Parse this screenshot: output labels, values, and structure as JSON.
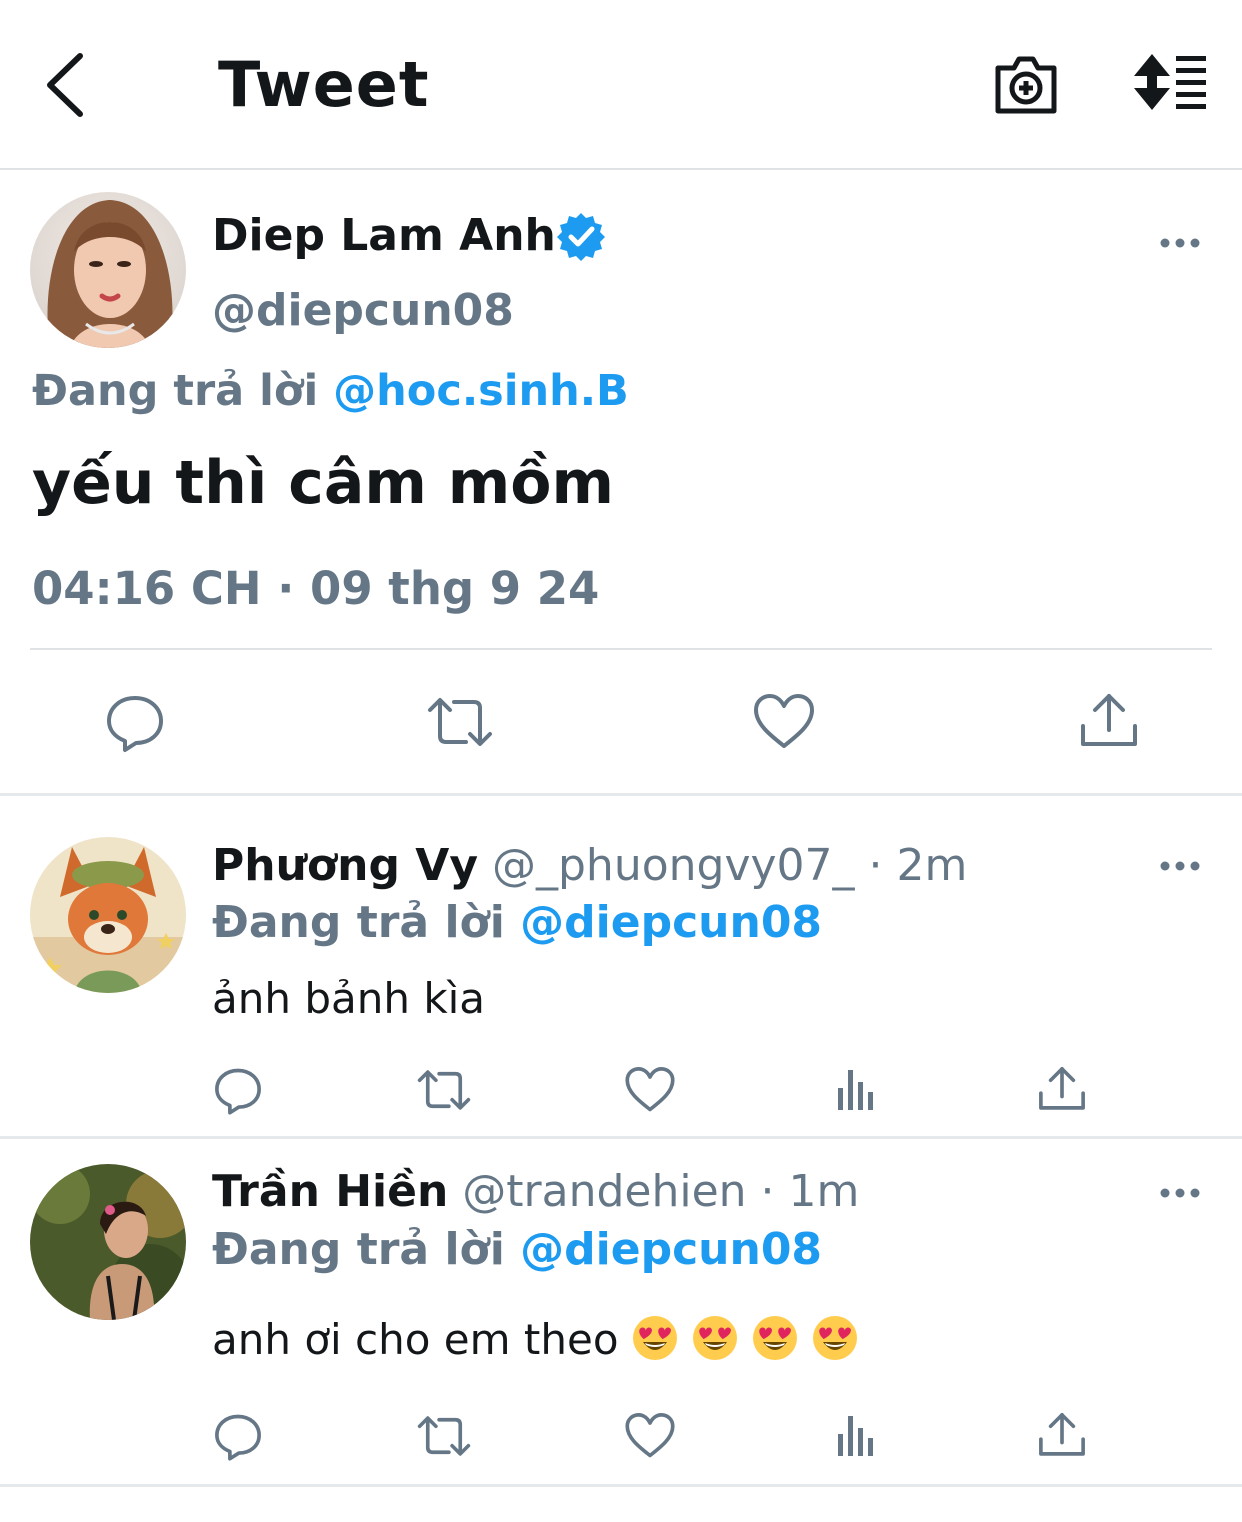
{
  "header": {
    "title": "Tweet"
  },
  "main_tweet": {
    "display_name": "Diep Lam Anh",
    "handle": "@diepcun08",
    "replying_prefix": "Đang trả lời",
    "replying_to": "@hoc.sinh.B",
    "text": "yếu thì câm mồm",
    "timestamp": "04:16 CH · 09 thg 9 24"
  },
  "replies": [
    {
      "display_name": "Phương Vy",
      "meta": "@_phuongvy07_ · 2m",
      "replying_prefix": "Đang trả lời",
      "replying_to": "@diepcun08",
      "text": "ảnh bảnh kìa"
    },
    {
      "display_name": "Trần Hiền",
      "meta": "@trandehien · 1m",
      "replying_prefix": "Đang trả lời",
      "replying_to": "@diepcun08",
      "text": "anh ơi cho em theo",
      "emoji_count": 4
    }
  ],
  "colors": {
    "accent": "#1d9bf0",
    "secondary_text": "#657786",
    "primary_text": "#14171a",
    "icon": "#657786"
  },
  "icons": {
    "back": "chevron-left-icon",
    "camera": "camera-plus-icon",
    "sort": "sort-icon",
    "verified": "verified-badge-icon",
    "more": "more-horizontal-icon",
    "reply": "reply-icon",
    "retweet": "retweet-icon",
    "like": "heart-icon",
    "analytics": "analytics-icon",
    "share": "share-icon",
    "emoji": "heart-eyes-emoji"
  }
}
